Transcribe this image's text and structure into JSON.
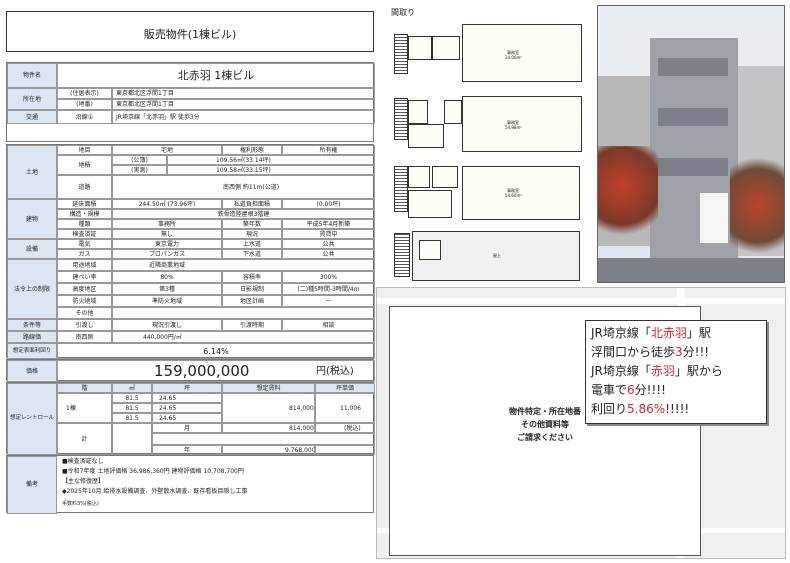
{
  "header": {
    "title": "販売物件(1棟ビル)"
  },
  "property": {
    "name_label": "物件名",
    "name": "北赤羽 1棟ビル",
    "address_label": "所在地",
    "addr_display_tag": "(住居表示)",
    "addr_display": "東京都北区浮間1丁目",
    "addr_lot_tag": "(地番)",
    "addr_lot": "東京都北区浮間1丁目",
    "transport_label": "交通",
    "line_tag": "沿線①",
    "line": "JR埼京線「北赤羽」駅 徒歩3分"
  },
  "land": {
    "label": "土地",
    "category_label": "地目",
    "category": "宅地",
    "rights_label": "権利形態",
    "rights": "所有権",
    "area_label": "地積",
    "area_public_tag": "(公簿)",
    "area_public": "109.56㎡(33.14坪)",
    "area_actual_tag": "(実測)",
    "area_actual": "109.58㎡(33.15坪)",
    "road_label": "道路",
    "road": "南西側 約11m(公道)"
  },
  "building": {
    "label": "建物",
    "floor_area_label": "延床面積",
    "floor_area": "244.50㎡ (73.96坪)",
    "private_road_label": "私道負担面積",
    "private_road": "(0.00坪)",
    "structure_label": "構造・規模",
    "structure": "鉄骨造陸屋根3階建",
    "use_label": "種類",
    "use": "事務所",
    "built_label": "築年数",
    "built": "平成5年4月新築",
    "inspection_label": "検査済証",
    "inspection": "無し",
    "status_label": "現況",
    "status": "賃貸中"
  },
  "facilities": {
    "label": "設備",
    "electric_label": "電気",
    "electric": "東京電力",
    "water_label": "上水道",
    "water": "公共",
    "gas_label": "ガス",
    "gas": "プロパンガス",
    "sewer_label": "下水道",
    "sewer": "公共"
  },
  "regulations": {
    "label": "法令上の制限",
    "zoning_label": "用途地域",
    "zoning": "近隣商業地域",
    "bcr_label": "建ぺい率",
    "bcr": "80%",
    "far_label": "容積率",
    "far": "300%",
    "height_label": "高度地区",
    "height": "第3種",
    "shade_label": "日影規制",
    "shade": "(二)種5時間-3時間/4m",
    "fire_label": "防火地域",
    "fire": "準防火地域",
    "district_label": "地区計画",
    "district": "ー",
    "other_label": "その他"
  },
  "terms": {
    "label": "条件等",
    "delivery_label": "引渡し",
    "delivery": "現況引渡し",
    "timing_label": "引渡時期",
    "timing": "相談"
  },
  "road_price": {
    "label": "路線価",
    "dir": "南西側",
    "value": "440,000円/㎡"
  },
  "yield": {
    "label": "想定表面利回り",
    "value": "6.14%"
  },
  "price": {
    "label": "価格",
    "value": "159,000,000",
    "unit": "円(税込)"
  },
  "rent_roll": {
    "label": "想定レントロール",
    "headers": [
      "階",
      "㎡",
      "坪",
      "想定賃料",
      "坪単価"
    ],
    "building_tag": "1棟",
    "rows": [
      {
        "m2": "81.5",
        "tsubo": "24.65"
      },
      {
        "m2": "81.5",
        "tsubo": "24.65"
      },
      {
        "m2": "81.5",
        "tsubo": "24.65"
      }
    ],
    "rent": "814,000",
    "unit_price": "11,006",
    "total_label": "計",
    "month_label": "月",
    "month": "814,000",
    "tax": "(税込)",
    "year_label": "年",
    "year": "9,768,000"
  },
  "notes": {
    "label": "備考",
    "lines": [
      "■検査済証なし",
      "■令和7年度 土地評価格 36,986,360円 建物評価格 10,708,700円",
      "【主な修復歴】",
      "◆2025年10月 給排水設備調査、外壁散水調査、既存看板目隠し工事",
      "手数料3%(税込)"
    ]
  },
  "floorplan": {
    "title": "間取り",
    "floor3_room": "事務室",
    "floor3_area": "34.06m²",
    "floor2_room": "事務室",
    "floor2_area": "54.98m²",
    "floor1_room": "事務室",
    "floor1_area": "54.60m²",
    "rooftop": "屋上"
  },
  "map": {
    "notice": [
      "物件特定・所在地番",
      "その他資料等",
      "ご請求ください"
    ]
  },
  "promo": {
    "l1a": "JR埼京線「",
    "l1b": "北赤羽",
    "l1c": "」駅",
    "l2a": "浮間口から徒歩",
    "l2b": "3",
    "l2c": "分!!!",
    "l3a": "JR埼京線「",
    "l3b": "赤羽",
    "l3c": "」駅から",
    "l4a": "電車で",
    "l4b": "6",
    "l4c": "分!!!!",
    "l5a": "利回り",
    "l5b": "5.86%",
    "l5c": "!!!!!"
  },
  "colors": {
    "accent": "#e0202b",
    "label_bg": "#dbe6f2"
  }
}
